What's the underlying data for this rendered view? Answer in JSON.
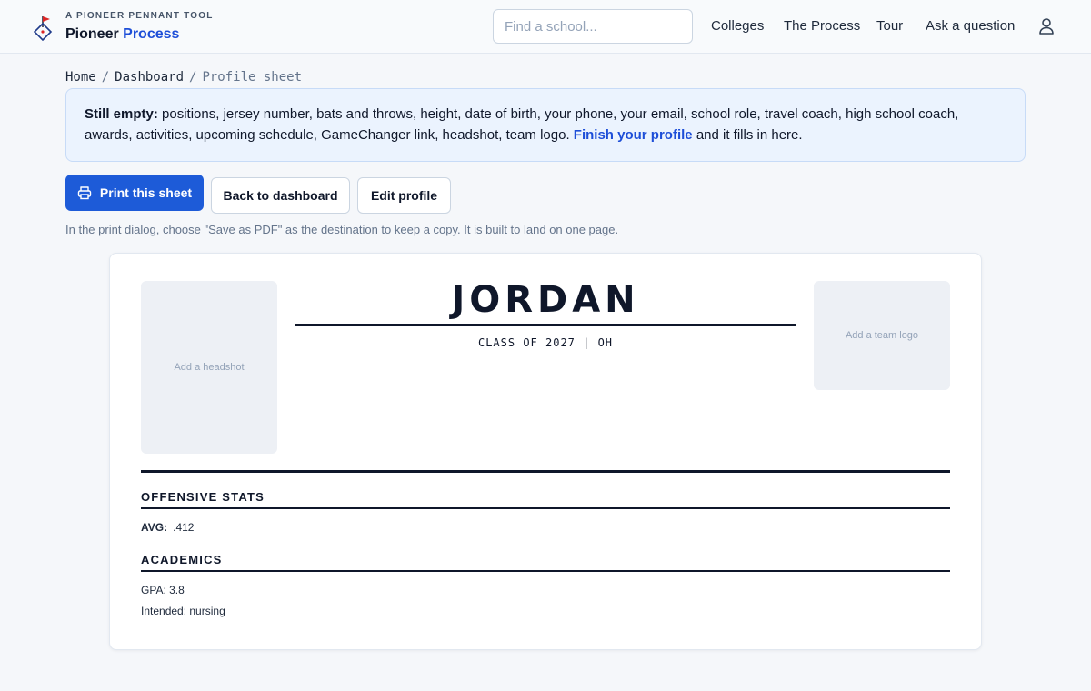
{
  "header": {
    "tagline": "A PIONEER PENNANT TOOL",
    "brand_primary": "Pioneer",
    "brand_accent": "Process",
    "search_placeholder": "Find a school...",
    "nav": {
      "colleges": "Colleges",
      "process": "The Process",
      "tour": "Tour",
      "ask": "Ask a question"
    },
    "user_icon": "user-icon",
    "logo_icon": "pennant-diamond-icon"
  },
  "breadcrumb": {
    "home": "Home",
    "sep": "/",
    "dashboard": "Dashboard",
    "current": "Profile sheet"
  },
  "notice": {
    "label": "Still empty:",
    "text": "positions, jersey number, bats and throws, height, date of birth, your phone, your email, school role, travel coach, high school coach, awards, activities, upcoming schedule, GameChanger link, headshot, team logo.",
    "link": "Finish your profile",
    "tail": "and it fills in here."
  },
  "actions": {
    "print": "Print this sheet",
    "print_icon": "printer-icon",
    "back": "Back to dashboard",
    "edit": "Edit profile",
    "hint": "In the print dialog, choose \"Save as PDF\" as the destination to keep a copy. It is built to land on one page."
  },
  "sheet": {
    "headshot_placeholder": "Add a headshot",
    "logo_placeholder": "Add a team logo",
    "name": "JORDAN",
    "class_line": "CLASS OF 2027 | OH",
    "offense": {
      "title": "OFFENSIVE STATS",
      "avg_label": "AVG:",
      "avg_value": ".412"
    },
    "academics": {
      "title": "ACADEMICS",
      "gpa": "GPA: 3.8",
      "intended": "Intended: nursing"
    }
  },
  "colors": {
    "accent": "#1d5bd8",
    "brand_blue": "#1d4ed8",
    "notice_bg": "#ebf3fe",
    "ink": "#0f172a"
  }
}
